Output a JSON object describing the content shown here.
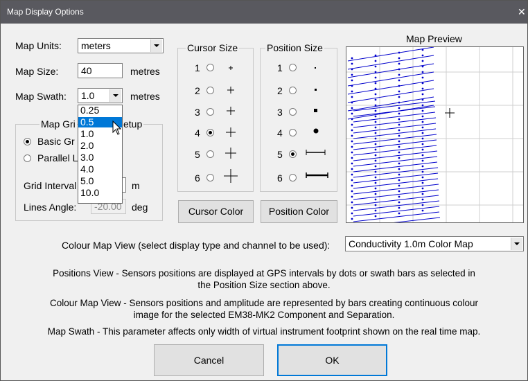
{
  "window": {
    "title": "Map Display Options",
    "close_glyph": "✕"
  },
  "map_units": {
    "label": "Map Units:",
    "value": "meters"
  },
  "map_size": {
    "label": "Map Size:",
    "value": "40",
    "unit": "metres"
  },
  "map_swath": {
    "label": "Map Swath:",
    "value": "1.0",
    "unit": "metres",
    "options": [
      "0.25",
      "0.5",
      "1.0",
      "2.0",
      "3.0",
      "4.0",
      "5.0",
      "10.0"
    ],
    "highlighted": "0.5"
  },
  "grid_setup": {
    "caption_left": "Map Gri",
    "caption_right": "etup",
    "basic": "Basic Gr",
    "parallel": "Parallel L",
    "interval_label": "Grid Interval",
    "interval_unit": "m",
    "angle_label": "Lines Angle:",
    "angle_value": "-20.00",
    "angle_unit": "deg"
  },
  "cursor_size": {
    "caption": "Cursor Size",
    "items": [
      "1",
      "2",
      "3",
      "4",
      "5",
      "6"
    ],
    "selected": "4",
    "color_button": "Cursor Color"
  },
  "position_size": {
    "caption": "Position Size",
    "items": [
      "1",
      "2",
      "3",
      "4",
      "5",
      "6"
    ],
    "selected": "5",
    "color_button": "Position Color"
  },
  "map_preview": {
    "caption": "Map Preview"
  },
  "colour_map": {
    "label": "Colour Map View (select display type and channel to be used):",
    "value": "Conductivity 1.0m Color Map"
  },
  "help": {
    "line1": "Positions View - Sensors positions are displayed at GPS intervals by dots or swath bars as selected in",
    "line2": "the Position Size section above.",
    "line3": "Colour Map View - Sensors positions and amplitude are represented by bars creating continuous colour",
    "line4": "image for the selected EM38-MK2 Component and Separation.",
    "line5": "Map Swath - This parameter affects only width of virtual instrument footprint shown on the real time map."
  },
  "buttons": {
    "cancel": "Cancel",
    "ok": "OK"
  },
  "colors": {
    "titlebar": "#59595f",
    "highlight": "#0078d7",
    "track": "#0000cc"
  }
}
